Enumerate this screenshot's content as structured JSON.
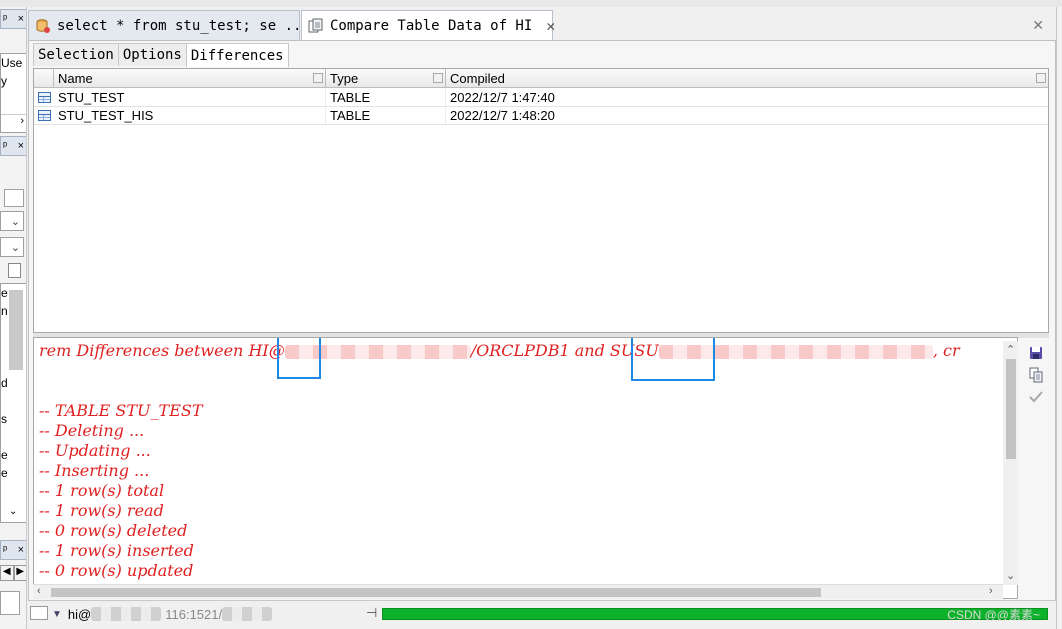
{
  "tabs": [
    {
      "label": "select * from stu_test; se ..."
    },
    {
      "label": "Compare Table Data of HI"
    }
  ],
  "close_glyph": "✕",
  "subtabs": [
    {
      "label": "Selection"
    },
    {
      "label": "Options"
    },
    {
      "label": "Differences"
    }
  ],
  "grid": {
    "columns": [
      "Name",
      "Type",
      "Compiled"
    ],
    "rows": [
      {
        "name": "STU_TEST",
        "type": "TABLE",
        "compiled": "2022/12/7 1:47:40"
      },
      {
        "name": "STU_TEST_HIS",
        "type": "TABLE",
        "compiled": "2022/12/7 1:48:20"
      }
    ]
  },
  "editor": {
    "header_parts": [
      "rem Differences between HI@",
      "/ORCLPDB1 and SUSU",
      ", cr"
    ],
    "lines": [
      "-- TABLE STU_TEST",
      "-- Deleting ...",
      "-- Updating ...",
      "-- Inserting ...",
      "-- 1 row(s) total",
      "-- 1 row(s) read",
      "-- 0 row(s) deleted",
      "-- 1 row(s) inserted",
      "-- 0 row(s) updated"
    ]
  },
  "left_panel": {
    "labels": [
      "Use",
      "y",
      "e",
      "n",
      "d",
      "s",
      "e",
      "e"
    ]
  },
  "status": {
    "connection_prefix": "hi@",
    "connection_visible": "116:1521/",
    "progress": 1.0
  },
  "watermark": "CSDN @@素素~",
  "colors": {
    "code_red": "#e02020",
    "highlight_blue": "#1e88e5",
    "progress_green": "#0cb32a"
  }
}
